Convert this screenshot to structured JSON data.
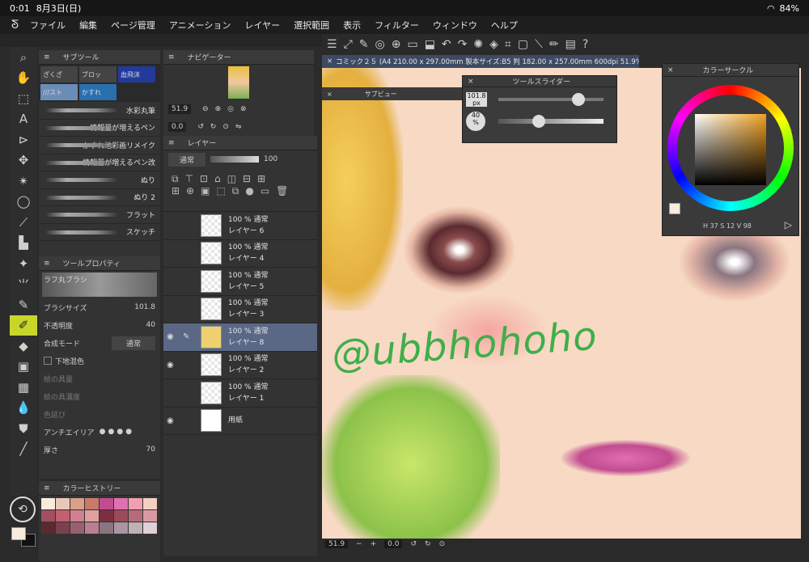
{
  "status": {
    "time": "0:01",
    "date": "8月3日(日)",
    "battery": "84%"
  },
  "menu": [
    "ファイル",
    "編集",
    "ページ管理",
    "アニメーション",
    "レイヤー",
    "選択範囲",
    "表示",
    "フィルター",
    "ウィンドウ",
    "ヘルプ"
  ],
  "subtool": {
    "title": "サブツール",
    "tabs": [
      "ざくざ",
      "ブロッ",
      "血飛沫",
      "///スト",
      "かすれ"
    ],
    "brushes": [
      "水彩丸筆",
      "情報量が増えるペン",
      "かすれ池彩画リメイク",
      "情報量が増えるペン改",
      "ぬり",
      "ぬり 2",
      "フラット",
      "スケッチ"
    ]
  },
  "toolprop": {
    "title": "ツールプロパティ",
    "brush_name": "ラフ丸ブラシ",
    "size_label": "ブラシサイズ",
    "size_value": "101.8",
    "opacity_label": "不透明度",
    "opacity_value": "40",
    "blend_label": "合成モード",
    "blend_value": "通常",
    "under_label": "下地混色",
    "paint_amount": "絵の具量",
    "paint_density": "絵の具濃度",
    "color_stretch": "色延び",
    "antialias": "アンチエイリア",
    "thickness": "厚さ",
    "thickness_value": "70"
  },
  "navigator": {
    "title": "ナビゲーター",
    "zoom": "51.9",
    "angle": "0.0"
  },
  "layers": {
    "title": "レイヤー",
    "blend": "通常",
    "opacity": "100",
    "rows": [
      {
        "pct": "100 % 通常",
        "name": "レイヤー 6"
      },
      {
        "pct": "100 % 通常",
        "name": "レイヤー 4"
      },
      {
        "pct": "100 % 通常",
        "name": "レイヤー 5"
      },
      {
        "pct": "100 % 通常",
        "name": "レイヤー 3"
      },
      {
        "pct": "100 % 通常",
        "name": "レイヤー 8"
      },
      {
        "pct": "100 % 通常",
        "name": "レイヤー 2"
      },
      {
        "pct": "100 % 通常",
        "name": "レイヤー 1"
      },
      {
        "pct": "",
        "name": "用紙"
      }
    ]
  },
  "subview_title": "サブビュー",
  "doc_tab": "コミック２５ (A4 210.00 x 297.00mm 製本サイズ:B5 判 182.00 x 257.00mm 600dpi 51.9%)",
  "tool_slider": {
    "title": "ツールスライダー",
    "size": "101.8",
    "size_unit": "px",
    "opacity": "40",
    "opacity_unit": "%"
  },
  "color_circle": {
    "title": "カラーサークル",
    "h": "37",
    "s": "12",
    "v": "98",
    "h_label": "H",
    "s_label": "S",
    "v_label": "V"
  },
  "color_history": {
    "title": "カラーヒストリー"
  },
  "canvas_text": "@ubbhohoho",
  "bottom": {
    "zoom": "51.9",
    "angle": "0.0"
  },
  "colors": {
    "accent": "#5a6886",
    "watermark": "#3fae4a"
  }
}
